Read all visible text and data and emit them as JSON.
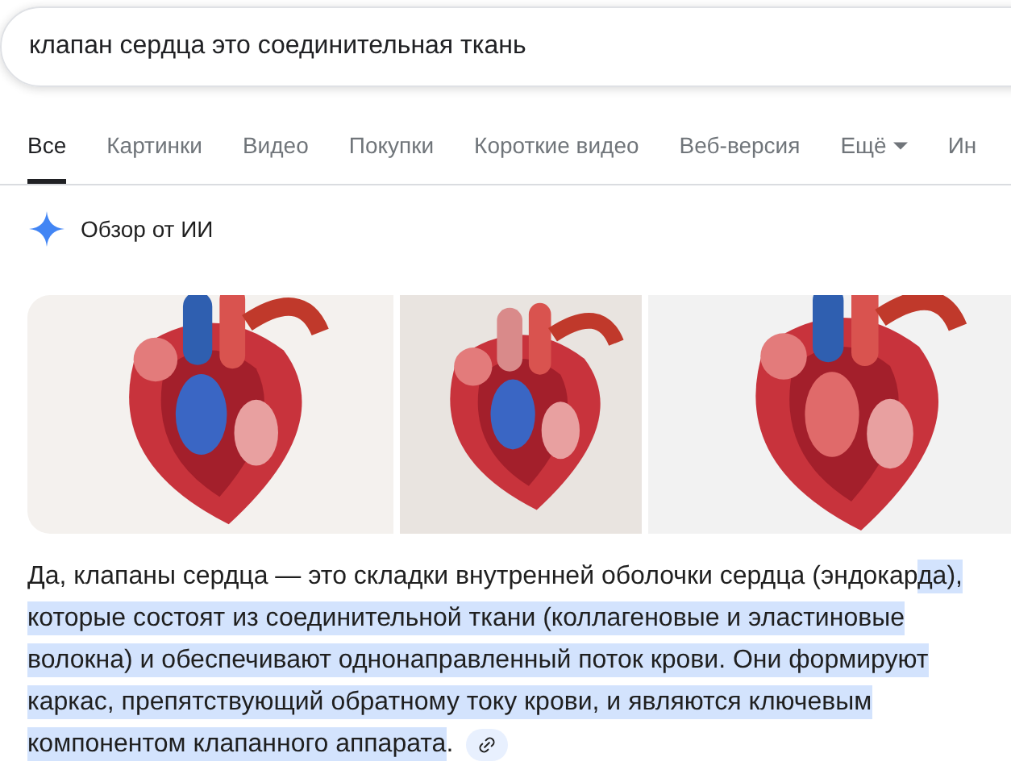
{
  "search": {
    "value": "клапан сердца это соединительная ткань"
  },
  "tabs": [
    {
      "label": "Все",
      "selected": true,
      "dropdown": false
    },
    {
      "label": "Картинки",
      "selected": false,
      "dropdown": false
    },
    {
      "label": "Видео",
      "selected": false,
      "dropdown": false
    },
    {
      "label": "Покупки",
      "selected": false,
      "dropdown": false
    },
    {
      "label": "Короткие видео",
      "selected": false,
      "dropdown": false
    },
    {
      "label": "Веб-версия",
      "selected": false,
      "dropdown": false
    },
    {
      "label": "Ещё",
      "selected": false,
      "dropdown": true
    },
    {
      "label": "Ин",
      "selected": false,
      "dropdown": false
    }
  ],
  "ai_overview": {
    "title": "Обзор от ИИ",
    "answer": {
      "text_plain": "Да, клапаны сердца — это складки внутренней оболочки сердца (эндокар",
      "text_highlighted": "да), которые состоят из соединительной ткани (коллагеновые и эластиновые волокна) и обеспечивают однонаправленный поток крови. Они формируют каркас, препятствующий обратному току крови, и являются ключевым компонентом клапанного аппарата",
      "text_after": "."
    }
  }
}
